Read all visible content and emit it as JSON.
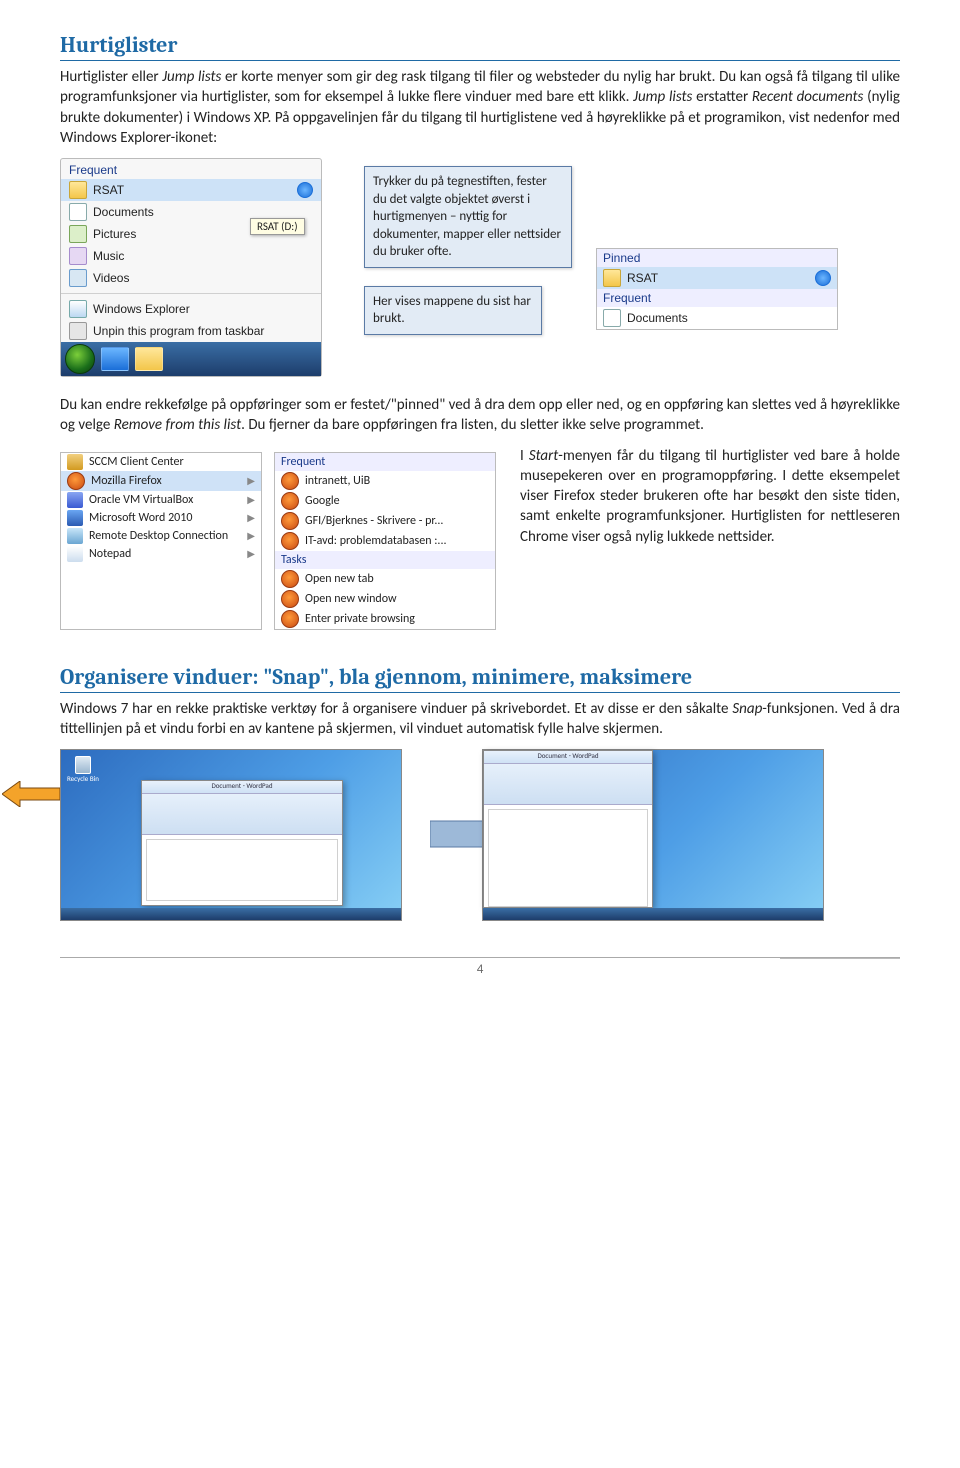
{
  "h1": "Hurtiglister",
  "para1a": "Hurtiglister eller ",
  "para1b": "Jump lists",
  "para1c": " er korte menyer som gir deg rask tilgang til filer og websteder du nylig har brukt. Du kan også få tilgang til ulike programfunksjoner via hurtiglister, som for eksempel å lukke flere vinduer med bare ett klikk. ",
  "para1d": "Jump lists",
  "para1e": " erstatter ",
  "para1f": "Recent documents",
  "para1g": " (nylig brukte dokumenter) i Windows XP. På oppgavelinjen får du tilgang til hurtiglistene ved å høyreklikke på et programikon, vist nedenfor med Windows Explorer-ikonet:",
  "jump1": {
    "hdr": "Frequent",
    "rsat": "RSAT",
    "docs": "Documents",
    "pics": "Pictures",
    "music": "Music",
    "videos": "Videos",
    "we": "Windows Explorer",
    "unpin": "Unpin this program from taskbar",
    "tooltip": "RSAT (D:)"
  },
  "noteTop": "Trykker du på tegnestiften, fester du det valgte objektet øverst i hurtigmenyen – nyttig for dokumenter, mapper eller nettsider du bruker ofte.",
  "noteBottom": "Her vises mappene du sist har brukt.",
  "jump2": {
    "pinned": "Pinned",
    "rsat": "RSAT",
    "freq": "Frequent",
    "docs": "Documents"
  },
  "para2a": "Du kan endre rekkefølge på oppføringer som er festet/\"pinned\" ved å dra dem opp eller ned, og en oppføring kan slettes ved å høyreklikke og velge ",
  "para2b": "Remove from this list",
  "para2c": ". Du fjerner da bare oppføringen fra listen, du sletter ikke selve programmet.",
  "startLeft": {
    "sccm": "SCCM Client Center",
    "ff": "Mozilla Firefox",
    "vb": "Oracle VM VirtualBox",
    "word": "Microsoft Word 2010",
    "rd": "Remote Desktop Connection",
    "np": "Notepad"
  },
  "startRight": {
    "hdr": "Frequent",
    "i1": "intranett, UiB",
    "i2": "Google",
    "i3": "GFI/Bjerknes - Skrivere - pr...",
    "i4": "IT-avd: problemdatabasen :...",
    "tasks": "Tasks",
    "t1": "Open new tab",
    "t2": "Open new window",
    "t3": "Enter private browsing"
  },
  "para3a": "I ",
  "para3b": "Start",
  "para3c": "-menyen får du tilgang til hurtiglister ved bare å holde musepekeren over en programoppføring. I dette eksempelet viser Firefox steder brukeren ofte har besøkt den siste tiden, samt enkelte programfunksjoner. Hurtiglisten for nettleseren Chrome viser også nylig lukkede nettsider.",
  "h2": "Organisere vinduer: \"Snap\", bla gjennom, minimere, maksimere",
  "para4a": "Windows 7 har en rekke praktiske verktøy for å organisere vinduer på skrivebordet. Et av disse er den såkalte ",
  "para4b": "Snap",
  "para4c": "-funksjonen. Ved å dra tittellinjen på et vindu forbi en av kantene på skjermen, vil vinduet automatisk fylle halve skjermen.",
  "recycle": "Recycle Bin",
  "wpadTitle": "Document - WordPad",
  "pageNum": "4"
}
